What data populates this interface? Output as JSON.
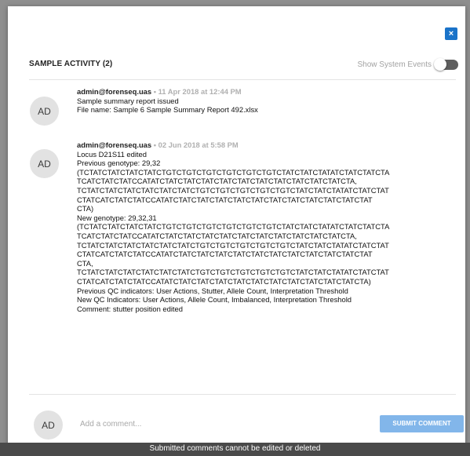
{
  "modal": {
    "close_label": "×",
    "title": "SAMPLE ACTIVITY (2)",
    "toggle_label": "Show System Events",
    "toggle_on": false
  },
  "entries": [
    {
      "avatar": "AD",
      "user": "admin@forenseq.uas",
      "separator": " • ",
      "timestamp": "11 Apr 2018 at 12:44 PM",
      "lines": [
        "Sample summary report issued",
        "File name: Sample 6 Sample Summary Report 492.xlsx"
      ]
    },
    {
      "avatar": "AD",
      "user": "admin@forenseq.uas",
      "separator": " • ",
      "timestamp": "02 Jun 2018 at 5:58 PM",
      "lines": [
        "Locus D21S11 edited",
        "Previous genotype: 29,32",
        "(TCTATCTATCTATCTATCTGTCTGTCTGTCTGTCTGTCTGTCTATCTATCTATATCTATCTATCTA",
        "TCATCTATCTATCCATATCTATCTATCTATCTATCTATCTATCTATCTATCTATCTATCTA,",
        "TCTATCTATCTATCTATCTATCTATCTGTCTGTCTGTCTGTCTGTCTATCTATCTATATCTATCTAT",
        "CTATCATCTATCTATCCATATCTATCTATCTATCTATCTATCTATCTATCTATCTATCTATCTAT",
        "CTA)",
        "New genotype: 29,32,31",
        "(TCTATCTATCTATCTATCTGTCTGTCTGTCTGTCTGTCTGTCTATCTATCTATATCTATCTATCTA",
        "TCATCTATCTATCCATATCTATCTATCTATCTATCTATCTATCTATCTATCTATCTATCTA,",
        "TCTATCTATCTATCTATCTATCTATCTGTCTGTCTGTCTGTCTGTCTATCTATCTATATCTATCTAT",
        "CTATCATCTATCTATCCATATCTATCTATCTATCTATCTATCTATCTATCTATCTATCTATCTAT",
        "CTA,",
        "TCTATCTATCTATCTATCTATCTATCTGTCTGTCTGTCTGTCTGTCTATCTATCTATATCTATCTAT",
        "CTATCATCTATCTATCCATATCTATCTATCTATCTATCTATCTATCTATCTATCTATCTATCTA)",
        "Previous QC indicators: User Actions, Stutter, Allele Count, Interpretation Threshold",
        "New QC Indicators: User Actions, Allele Count, Imbalanced, Interpretation Threshold",
        "Comment: stutter position edited"
      ]
    }
  ],
  "comment_box": {
    "avatar": "AD",
    "placeholder": "Add a comment...",
    "value": "",
    "submit_label": "SUBMIT COMMENT"
  },
  "footer": {
    "notice": "Submitted comments cannot be edited or deleted"
  }
}
